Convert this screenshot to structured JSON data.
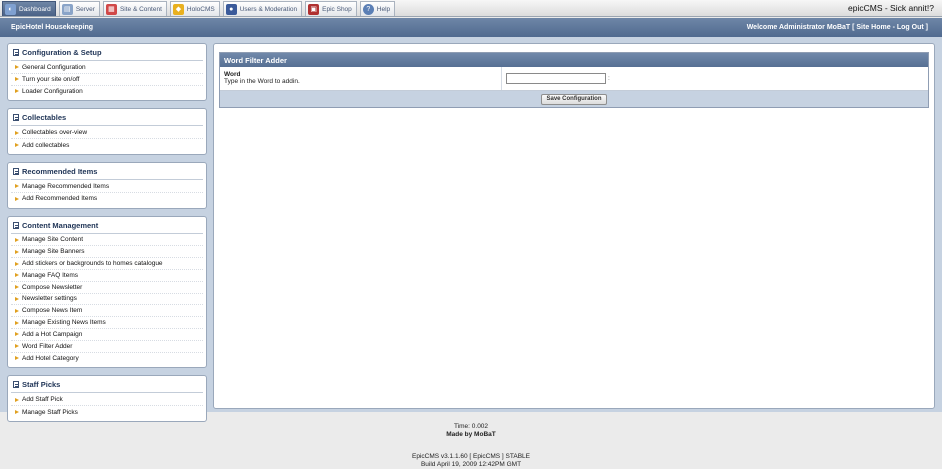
{
  "tabs": [
    {
      "label": "Dashboard",
      "icon": "dashboard-icon",
      "active": true
    },
    {
      "label": "Server",
      "icon": "server-icon",
      "active": false
    },
    {
      "label": "Site & Content",
      "icon": "content-icon",
      "active": false
    },
    {
      "label": "HoloCMS",
      "icon": "holocms-icon",
      "active": false
    },
    {
      "label": "Users & Moderation",
      "icon": "users-icon",
      "active": false
    },
    {
      "label": "Epic Shop",
      "icon": "shop-icon",
      "active": false
    },
    {
      "label": "Help",
      "icon": "help-icon",
      "active": false
    }
  ],
  "brand": "epicCMS - Sick annit!?",
  "header": {
    "left": "EpicHotel Housekeeping",
    "welcome": "Welcome Administrator MoBaT [",
    "site_home": "Site Home",
    "sep": "-",
    "logout": "Log Out",
    "close": "]"
  },
  "sidebar": [
    {
      "title": "Configuration & Setup",
      "items": [
        "General Configuration",
        "Turn your site on/off",
        "Loader Configuration"
      ]
    },
    {
      "title": "Collectables",
      "items": [
        "Collectables over-view",
        "Add collectables"
      ]
    },
    {
      "title": "Recommended Items",
      "items": [
        "Manage Recommended Items",
        "Add Recommended Items"
      ]
    },
    {
      "title": "Content Management",
      "items": [
        "Manage Site Content",
        "Manage Site Banners",
        "Add stickers or backgrounds to homes catalogue",
        "Manage FAQ Items",
        "Compose Newsletter",
        "Newsletter settings",
        "Compose News Item",
        "Manage Existing News Items",
        "Add a Hot Campaign",
        "Word Filter Adder",
        "Add Hotel Category"
      ]
    },
    {
      "title": "Staff Picks",
      "items": [
        "Add Staff Pick",
        "Manage Staff Picks"
      ]
    }
  ],
  "form": {
    "title": "Word Filter Adder",
    "field_label": "Word",
    "field_desc": "Type in the Word to addin.",
    "field_value": "",
    "colon": ":",
    "save_label": "Save Configuration"
  },
  "footer": {
    "time": "Time: 0.002",
    "made_by": "Made by MoBaT",
    "version": "EpicCMS v3.1.1.60 [ EpicCMS ] STABLE",
    "build": "Build April 19, 2009 12:42PM GMT"
  },
  "colors": {
    "header_blue": "#506a8f",
    "content_bg": "#c6d2e1",
    "title_text": "#1f3456",
    "arrow": "#e0a020"
  }
}
